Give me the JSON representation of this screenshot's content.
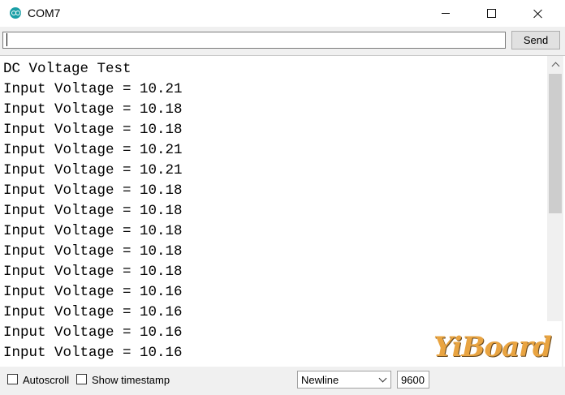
{
  "window": {
    "title": "COM7",
    "app_icon": "arduino-icon"
  },
  "send_bar": {
    "input_value": "",
    "send_label": "Send"
  },
  "output": {
    "lines": [
      "DC Voltage Test",
      "Input Voltage = 10.21",
      "Input Voltage = 10.18",
      "Input Voltage = 10.18",
      "Input Voltage = 10.21",
      "Input Voltage = 10.21",
      "Input Voltage = 10.18",
      "Input Voltage = 10.18",
      "Input Voltage = 10.18",
      "Input Voltage = 10.18",
      "Input Voltage = 10.18",
      "Input Voltage = 10.16",
      "Input Voltage = 10.16",
      "Input Voltage = 10.16",
      "Input Voltage = 10.16"
    ]
  },
  "footer": {
    "autoscroll_label": "Autoscroll",
    "autoscroll_checked": false,
    "timestamp_label": "Show timestamp",
    "timestamp_checked": false,
    "line_ending": "Newline",
    "baud": "9600"
  },
  "watermark": {
    "text": "YiBoard"
  },
  "colors": {
    "chrome_bg": "#f0f0f0",
    "arduino_teal": "#1a9fa6",
    "watermark_gold": "#e9a441"
  }
}
